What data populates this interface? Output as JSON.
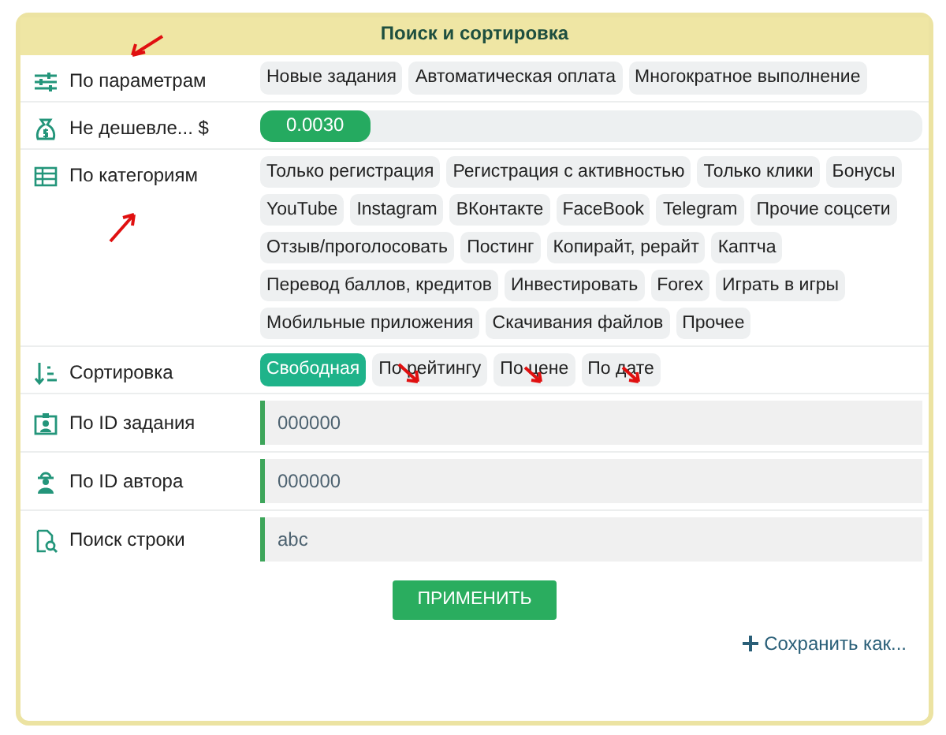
{
  "panel": {
    "title": "Поиск и сортировка"
  },
  "rows": [
    {
      "kind": "chips",
      "label": "По параметрам",
      "chips": [
        {
          "label": "Новые задания",
          "selected": false
        },
        {
          "label": "Автоматическая оплата",
          "selected": false
        },
        {
          "label": "Многократное выполнение",
          "selected": false
        }
      ]
    },
    {
      "kind": "slider",
      "label": "Не дешевле... $",
      "level": 0.166,
      "reading": "0.0030"
    },
    {
      "kind": "chips",
      "label": "По категориям",
      "chips": [
        {
          "label": "Только регистрация",
          "selected": false
        },
        {
          "label": "Регистрация с активностью",
          "selected": false
        },
        {
          "label": "Только клики",
          "selected": false
        },
        {
          "label": "Бонусы",
          "selected": false
        },
        {
          "label": "YouTube",
          "selected": false
        },
        {
          "label": "Instagram",
          "selected": false
        },
        {
          "label": "ВКонтакте",
          "selected": false
        },
        {
          "label": "FaceBook",
          "selected": false
        },
        {
          "label": "Telegram",
          "selected": false
        },
        {
          "label": "Прочие соцсети",
          "selected": false
        },
        {
          "label": "Отзыв/проголосовать",
          "selected": false
        },
        {
          "label": "Постинг",
          "selected": false
        },
        {
          "label": "Копирайт, рерайт",
          "selected": false
        },
        {
          "label": "Каптча",
          "selected": false
        },
        {
          "label": "Перевод баллов, кредитов",
          "selected": false
        },
        {
          "label": "Инвестировать",
          "selected": false
        },
        {
          "label": "Forex",
          "selected": false
        },
        {
          "label": "Играть в игры",
          "selected": false
        },
        {
          "label": "Мобильные приложения",
          "selected": false
        },
        {
          "label": "Скачивания файлов",
          "selected": false
        },
        {
          "label": "Прочее",
          "selected": false
        }
      ]
    },
    {
      "kind": "chips",
      "label": "Сортировка",
      "chips": [
        {
          "label": "Свободная",
          "selected": true
        },
        {
          "label": "По рейтингу",
          "selected": false
        },
        {
          "label": "По цене",
          "selected": false
        },
        {
          "label": "По дате",
          "selected": false
        }
      ]
    },
    {
      "kind": "field",
      "label": "По ID задания",
      "placeholder": "000000"
    },
    {
      "kind": "field",
      "label": "По ID автора",
      "placeholder": "000000"
    },
    {
      "kind": "field",
      "label": "Поиск строки",
      "placeholder": "abc"
    }
  ],
  "apply_button": "ПРИМЕНИТЬ",
  "save_link": "Сохранить как..."
}
